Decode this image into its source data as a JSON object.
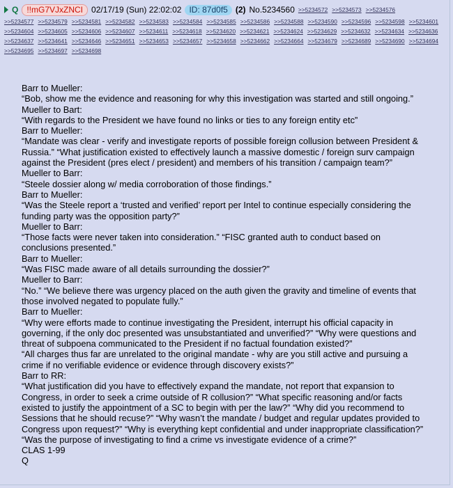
{
  "header": {
    "name": "Q",
    "tripcode": "!!mG7VJxZNCI",
    "date": "02/17/19 (Sun) 22:02:02",
    "id": "ID: 87d0f5",
    "reply_count": "(2)",
    "post_number": "No.5234560",
    "first_row_links": [
      ">>5234572",
      ">>5234573",
      ">>5234576"
    ],
    "backlinks": [
      ">>5234577",
      ">>5234579",
      ">>5234581",
      ">>5234582",
      ">>5234583",
      ">>5234584",
      ">>5234585",
      ">>5234586",
      ">>5234588",
      ">>5234590",
      ">>5234596",
      ">>5234598",
      ">>5234601",
      ">>5234604",
      ">>5234605",
      ">>5234606",
      ">>5234607",
      ">>5234611",
      ">>5234618",
      ">>5234620",
      ">>5234621",
      ">>5234624",
      ">>5234629",
      ">>5234632",
      ">>5234634",
      ">>5234636",
      ">>5234637",
      ">>5234641",
      ">>5234646",
      ">>5234651",
      ">>5234653",
      ">>5234657",
      ">>5234658",
      ">>5234662",
      ">>5234664",
      ">>5234679",
      ">>5234689",
      ">>5234690",
      ">>5234694",
      ">>5234695",
      ">>5234697",
      ">>5234698"
    ]
  },
  "message_lines": [
    "Barr to Mueller:",
    "“Bob, show me the evidence and reasoning for why this investigation was started and still ongoing.”",
    "Mueller to Bart:",
    "“With regards to the President we have found no links or ties to any foreign entity etc”",
    "Barr to Mueller:",
    "“Mandate was clear - verify and investigate reports of possible foreign collusion between President & Russia.” “What justification existed to effectively launch a massive domestic / foreign surv campaign against the President (pres elect / president) and members of his transition / campaign team?”",
    "Mueller to Barr:",
    "“Steele dossier along w/ media corroboration of those findings.”",
    "Barr to Mueller:",
    "“Was the Steele report a ‘trusted and verified’ report per Intel to continue especially considering the funding party was the opposition party?”",
    "Mueller to Barr:",
    "“Those facts were never taken into consideration.” “FISC granted auth to conduct based on conclusions presented.”",
    "Barr to Mueller:",
    "“Was FISC made aware of all details surrounding the dossier?”",
    "Mueller to Barr:",
    "“No.” “We believe there was urgency placed on the auth given the gravity and timeline of events that those involved negated to populate fully.”",
    "Barr to Mueller:",
    "“Why were efforts made to continue investigating the President, interrupt his official capacity in governing, if the only doc presented was unsubstantiated and unverified?” “Why were questions and threat of subpoena communicated to the President if no factual foundation existed?”",
    "“All charges thus far are unrelated to the original mandate - why are you still active and pursuing a crime if no verifiable evidence or evidence through discovery exists?”",
    "Barr to RR:",
    "“What justification did you have to effectively expand the mandate, not report that expansion to Congress, in order to seek a crime outside of R collusion?” “What specific reasoning and/or facts existed to justify the appointment of a SC to begin with per the law?” “Why did you recommend to Sessions that he should recuse?” “Why wasn’t the mandate / budget and regular updates provided to Congress upon request?” “Why is everything kept confidential and under inappropriate classification?” “Was the purpose of investigating to find a crime vs investigate evidence of a crime?”",
    "CLAS 1-99",
    "Q"
  ]
}
